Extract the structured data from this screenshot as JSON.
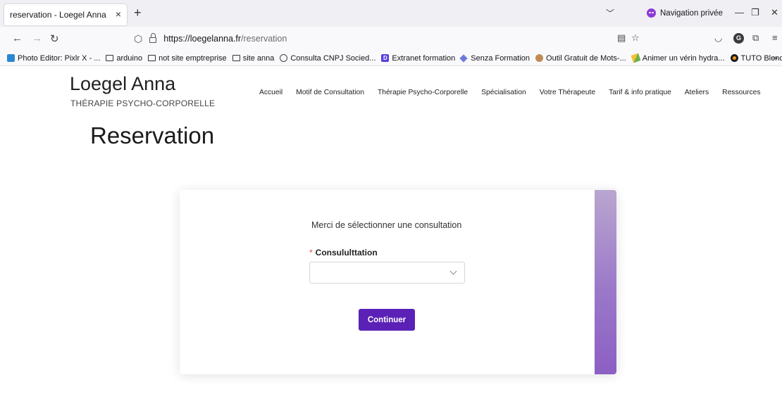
{
  "browser": {
    "tab_title": "reservation - Loegel Anna",
    "tab_close": "×",
    "new_tab": "+",
    "tab_list": "﹀",
    "private_label": "Navigation privée",
    "url_host": "https://loegelanna.fr",
    "url_path": "/reservation",
    "bookmarks": [
      {
        "label": "Photo Editor: Pixlr X - ...",
        "icon": "pixlr-icon"
      },
      {
        "label": "arduino",
        "icon": "folder-icon"
      },
      {
        "label": "not site emptreprise",
        "icon": "folder-icon"
      },
      {
        "label": "site anna",
        "icon": "folder-icon"
      },
      {
        "label": "Consulta CNPJ Socied...",
        "icon": "globe-icon"
      },
      {
        "label": "Extranet formation",
        "icon": "d-logo-icon"
      },
      {
        "label": "Senza Formation",
        "icon": "senza-icon"
      },
      {
        "label": "Outil Gratuit de Mots-...",
        "icon": "avatar-icon"
      },
      {
        "label": "Animer un vérin hydra...",
        "icon": "pencil-icon"
      },
      {
        "label": "TUTO Blender gratuit, ...",
        "icon": "blender-icon"
      }
    ],
    "bookmarks_more": "»"
  },
  "site": {
    "brand_name": "Loegel Anna",
    "brand_tagline": "THÉRAPIE PSYCHO-CORPORELLE",
    "nav": [
      "Accueil",
      "Motif de Consultation",
      "Thérapie Psycho-Corporelle",
      "Spécialisation",
      "Votre Thérapeute",
      "Tarif & info pratique",
      "Ateliers",
      "Ressources"
    ]
  },
  "main": {
    "title": "Reservation",
    "form": {
      "intro": "Merci de sélectionner une consultation",
      "required_mark": "*",
      "field_label": "Consululttation",
      "select_value": "",
      "submit_label": "Continuer"
    }
  },
  "colors": {
    "primary_button": "#5b21b6",
    "accent_strip": "#9a78c9",
    "required": "#e2473b"
  }
}
